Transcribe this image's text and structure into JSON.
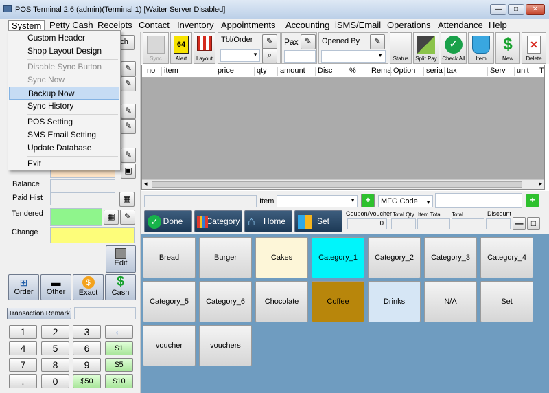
{
  "window": {
    "title": "POS Terminal 2.6 (admin)(Terminal 1) [Waiter Server Disabled]",
    "min": "—",
    "max": "□",
    "close": "✕"
  },
  "menu": [
    "System",
    "Petty Cash",
    "Receipts",
    "Contact",
    "Inventory",
    "Appointments",
    "Tbl/Order",
    "Accounting",
    "iSMS/Email",
    "Operations",
    "Attendance",
    "Help"
  ],
  "system_menu": {
    "items": [
      {
        "label": "Custom Header"
      },
      {
        "label": "Shop Layout Design"
      },
      {
        "label": "Disable Sync Button",
        "disabled": true
      },
      {
        "label": "Sync Now",
        "disabled": true
      },
      {
        "label": "Backup Now",
        "highlighted": true
      },
      {
        "label": "Sync History"
      },
      {
        "label": "POS Setting"
      },
      {
        "label": "SMS Email Setting"
      },
      {
        "label": "Update Database"
      },
      {
        "label": "Exit"
      }
    ]
  },
  "left": {
    "search_btn": "ach",
    "balance_label": "Balance",
    "paid_hist_label": "Paid Hist",
    "tendered_label": "Tendered",
    "change_label": "Change",
    "edit_label": "Edit",
    "order_label": "Order",
    "other_label": "Other",
    "exact_label": "Exact",
    "cash_label": "Cash",
    "remark_label": "Transaction Remark"
  },
  "keypad": [
    "1",
    "2",
    "3",
    "←",
    "4",
    "5",
    "6",
    "$1",
    "7",
    "8",
    "9",
    "$5",
    ".",
    "0",
    "$50",
    "$10"
  ],
  "toolbar": {
    "sync": "Sync",
    "alert": "Alert",
    "alert_count": "64",
    "layout": "Layout",
    "tblorder": "Tbl/Order",
    "pax": "Pax",
    "opened_by": "Opened By",
    "status": "Status",
    "split_pay": "Split Pay",
    "check_all": "Check All",
    "item": "Item",
    "new": "New",
    "delete": "Delete"
  },
  "grid": {
    "headers": [
      "no",
      "item",
      "price",
      "qty",
      "amount",
      "Disc",
      "%",
      "Rema",
      "Option",
      "seria",
      "tax",
      "Serv",
      "unit",
      "T"
    ]
  },
  "item_bar": {
    "item_label": "Item",
    "mfg_code": "MFG Code",
    "coupon_label": "Coupon/Voucher",
    "coupon_value": "0",
    "total_qty": "Total Qty",
    "item_total": "Item Total",
    "total": "Total",
    "discount": "Discount",
    "done": "Done",
    "category": "Category",
    "home": "Home",
    "set": "Set"
  },
  "categories": [
    {
      "label": "Bread",
      "color": "#dcdcdc"
    },
    {
      "label": "Burger",
      "color": "#dcdcdc"
    },
    {
      "label": "Cakes",
      "color": "#fdf6d8"
    },
    {
      "label": "Category_1",
      "color": "#00f5fb"
    },
    {
      "label": "Category_2",
      "color": "#dcdcdc"
    },
    {
      "label": "Category_3",
      "color": "#dcdcdc"
    },
    {
      "label": "Category_4",
      "color": "#dcdcdc"
    },
    {
      "label": "Category_5",
      "color": "#dcdcdc"
    },
    {
      "label": "Category_6",
      "color": "#dcdcdc"
    },
    {
      "label": "Chocolate",
      "color": "#dcdcdc"
    },
    {
      "label": "Coffee",
      "color": "#b8860b"
    },
    {
      "label": "Drinks",
      "color": "#d6e6f5"
    },
    {
      "label": "N/A",
      "color": "#dcdcdc"
    },
    {
      "label": "Set",
      "color": "#dcdcdc"
    },
    {
      "label": "voucher",
      "color": "#dcdcdc"
    },
    {
      "label": "vouchers",
      "color": "#dcdcdc"
    }
  ]
}
